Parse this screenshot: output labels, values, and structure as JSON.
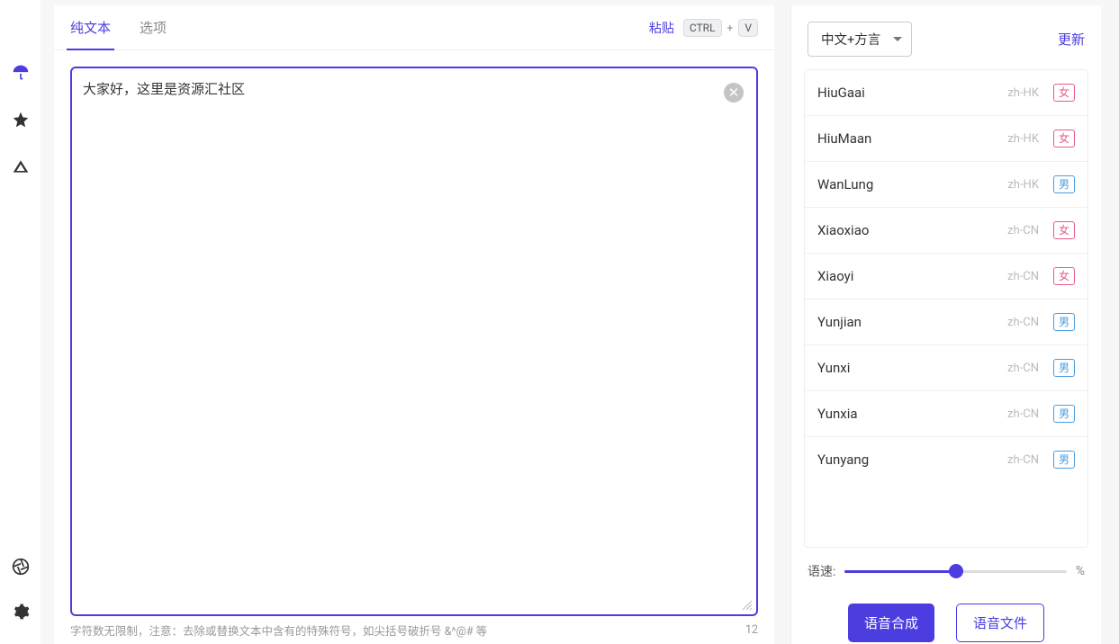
{
  "sidebar": {
    "icons": [
      "umbrella",
      "star",
      "triangle",
      "aperture",
      "gear"
    ]
  },
  "tabs": {
    "plain": "纯文本",
    "options": "选项"
  },
  "paste": {
    "label": "粘贴",
    "key1": "CTRL",
    "plus": "+",
    "key2": "V"
  },
  "textarea": {
    "value": "大家好，这里是资源汇社区"
  },
  "footer": {
    "hint": "字符数无限制，注意：去除或替换文本中含有的特殊符号，如尖括号破折号 &^@# 等",
    "count": "12"
  },
  "right": {
    "lang": "中文+方言",
    "refresh": "更新",
    "speed_label": "语速:",
    "pct_suffix": "%",
    "synth": "语音合成",
    "file": "语音文件"
  },
  "voices": [
    {
      "name": "HiuGaai",
      "locale": "zh-HK",
      "gender": "女"
    },
    {
      "name": "HiuMaan",
      "locale": "zh-HK",
      "gender": "女"
    },
    {
      "name": "WanLung",
      "locale": "zh-HK",
      "gender": "男"
    },
    {
      "name": "Xiaoxiao",
      "locale": "zh-CN",
      "gender": "女"
    },
    {
      "name": "Xiaoyi",
      "locale": "zh-CN",
      "gender": "女"
    },
    {
      "name": "Yunjian",
      "locale": "zh-CN",
      "gender": "男"
    },
    {
      "name": "Yunxi",
      "locale": "zh-CN",
      "gender": "男"
    },
    {
      "name": "Yunxia",
      "locale": "zh-CN",
      "gender": "男"
    },
    {
      "name": "Yunyang",
      "locale": "zh-CN",
      "gender": "男"
    }
  ]
}
